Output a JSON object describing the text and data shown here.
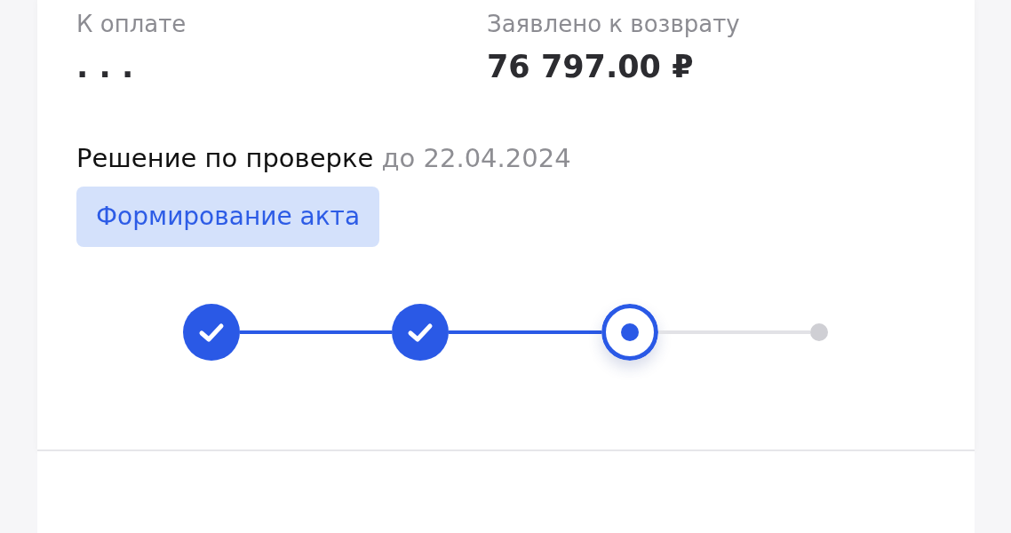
{
  "summary": [
    {
      "label": "К оплате",
      "value": ". . ."
    },
    {
      "label": "Заявлено к возврату",
      "value": "76 797.00 ₽"
    }
  ],
  "decision": {
    "title": "Решение по проверке",
    "deadline": "до 22.04.2024",
    "status": "Формирование акта"
  },
  "steps": [
    {
      "kind": "done"
    },
    {
      "kind": "done"
    },
    {
      "kind": "current"
    },
    {
      "kind": "pending"
    }
  ]
}
